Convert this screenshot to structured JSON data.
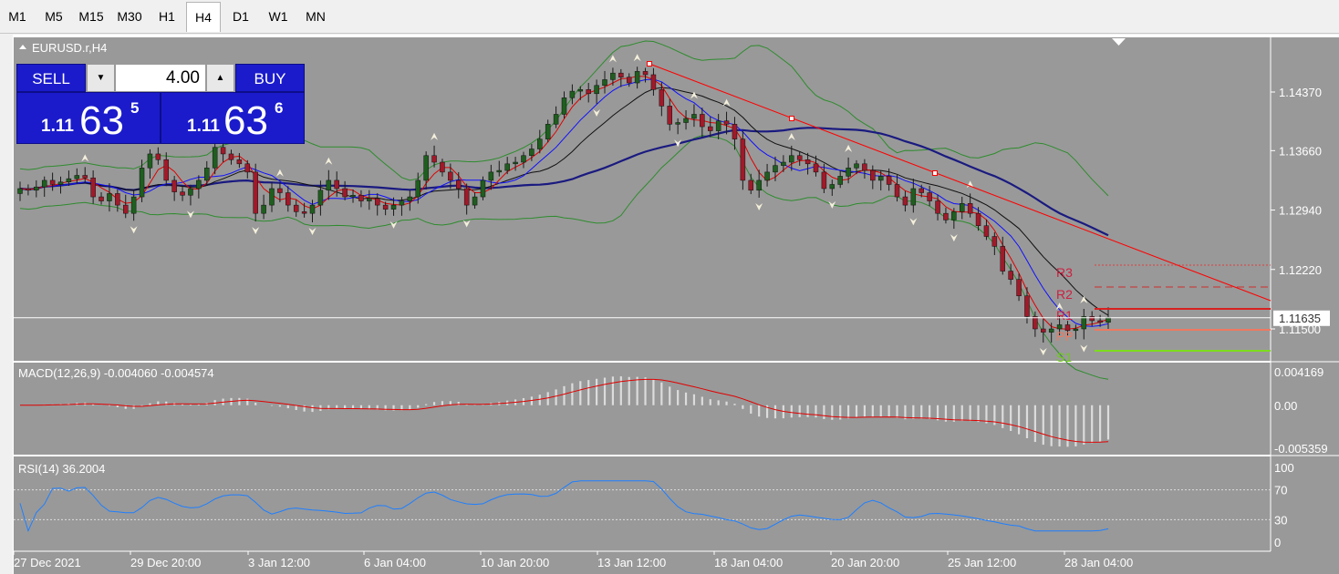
{
  "timeframes": [
    "M1",
    "M5",
    "M15",
    "M30",
    "H1",
    "H4",
    "D1",
    "W1",
    "MN"
  ],
  "active_timeframe": "H4",
  "symbol_label": "EURUSD.r,H4",
  "trade_panel": {
    "sell_label": "SELL",
    "buy_label": "BUY",
    "volume": "4.00",
    "down_arrow": "▼",
    "up_arrow": "▲",
    "sell_price_small": "1.11",
    "sell_price_big": "63",
    "sell_price_sup": "5",
    "buy_price_small": "1.11",
    "buy_price_big": "63",
    "buy_price_sup": "6"
  },
  "main_axis": {
    "ticks": [
      "1.14370",
      "1.13660",
      "1.12940",
      "1.12220",
      "1.11500"
    ],
    "current_price": "1.11635"
  },
  "pivot_labels": [
    "R3",
    "R2",
    "R1",
    "PP",
    "S1"
  ],
  "macd": {
    "label": "MACD(12,26,9) -0.004060 -0.004574",
    "ticks": [
      "0.004169",
      "0.00",
      "-0.005359"
    ]
  },
  "rsi": {
    "label": "RSI(14) 36.2004",
    "ticks": [
      "100",
      "70",
      "30",
      "0"
    ]
  },
  "time_axis": [
    "27 Dec 2021",
    "29 Dec 20:00",
    "3 Jan 12:00",
    "6 Jan 04:00",
    "10 Jan 20:00",
    "13 Jan 12:00",
    "18 Jan 04:00",
    "20 Jan 20:00",
    "25 Jan 12:00",
    "28 Jan 04:00"
  ],
  "colors": {
    "chart_bg": "#999999",
    "bull_candle": "#1f5e1f",
    "bear_candle": "#a11a2a",
    "ma_fast": "#e00000",
    "ma_mid": "#1010ff",
    "ma_slow": "#101010",
    "ma_long": "#1a1a80",
    "bollinger": "#2e8b2e",
    "trendline": "#ff0000",
    "macd_signal": "#e00000",
    "rsi_line": "#1e7fff",
    "panel_blue": "#1b1bcc"
  },
  "chart_data": {
    "type": "candlestick",
    "symbol": "EURUSD.r",
    "timeframe": "H4",
    "price_close": [
      1.132,
      1.1318,
      1.1322,
      1.133,
      1.1325,
      1.1328,
      1.1332,
      1.1336,
      1.1333,
      1.131,
      1.1305,
      1.1314,
      1.13,
      1.129,
      1.131,
      1.1345,
      1.1362,
      1.1355,
      1.133,
      1.1316,
      1.1312,
      1.132,
      1.133,
      1.1345,
      1.137,
      1.1362,
      1.1355,
      1.135,
      1.134,
      1.129,
      1.13,
      1.132,
      1.1315,
      1.13,
      1.1292,
      1.129,
      1.13,
      1.1318,
      1.133,
      1.132,
      1.131,
      1.1312,
      1.1305,
      1.1308,
      1.13,
      1.1295,
      1.13,
      1.1305,
      1.131,
      1.133,
      1.136,
      1.1352,
      1.134,
      1.133,
      1.132,
      1.13,
      1.131,
      1.133,
      1.134,
      1.1342,
      1.135,
      1.1352,
      1.136,
      1.1368,
      1.138,
      1.1398,
      1.141,
      1.143,
      1.1438,
      1.144,
      1.1435,
      1.1445,
      1.1452,
      1.146,
      1.1455,
      1.1448,
      1.1462,
      1.1458,
      1.144,
      1.142,
      1.1398,
      1.14,
      1.1405,
      1.141,
      1.1395,
      1.139,
      1.1402,
      1.1398,
      1.138,
      1.133,
      1.1318,
      1.133,
      1.134,
      1.1348,
      1.1352,
      1.136,
      1.1355,
      1.135,
      1.134,
      1.132,
      1.1325,
      1.1335,
      1.1345,
      1.135,
      1.1342,
      1.133,
      1.1335,
      1.1325,
      1.131,
      1.13,
      1.132,
      1.1315,
      1.1305,
      1.129,
      1.1282,
      1.1292,
      1.1302,
      1.129,
      1.1275,
      1.1262,
      1.125,
      1.122,
      1.121,
      1.119,
      1.1165,
      1.115,
      1.1146,
      1.115,
      1.1155,
      1.1148,
      1.115,
      1.1165,
      1.116,
      1.1158,
      1.1164
    ],
    "current_price": 1.11635,
    "price_ticks": [
      1.1437,
      1.1366,
      1.1294,
      1.1222,
      1.115
    ],
    "macd": {
      "main": -0.00406,
      "signal": -0.004574,
      "range": [
        -0.005359,
        0.004169
      ]
    },
    "rsi": {
      "value": 36.2004,
      "levels": [
        70,
        30
      ],
      "range": [
        0,
        100
      ]
    },
    "pivots": [
      "R3",
      "R2",
      "R1",
      "PP",
      "S1"
    ],
    "x_labels": [
      "27 Dec 2021",
      "29 Dec 20:00",
      "3 Jan 12:00",
      "6 Jan 04:00",
      "10 Jan 20:00",
      "13 Jan 12:00",
      "18 Jan 04:00",
      "20 Jan 20:00",
      "25 Jan 12:00",
      "28 Jan 04:00"
    ]
  }
}
